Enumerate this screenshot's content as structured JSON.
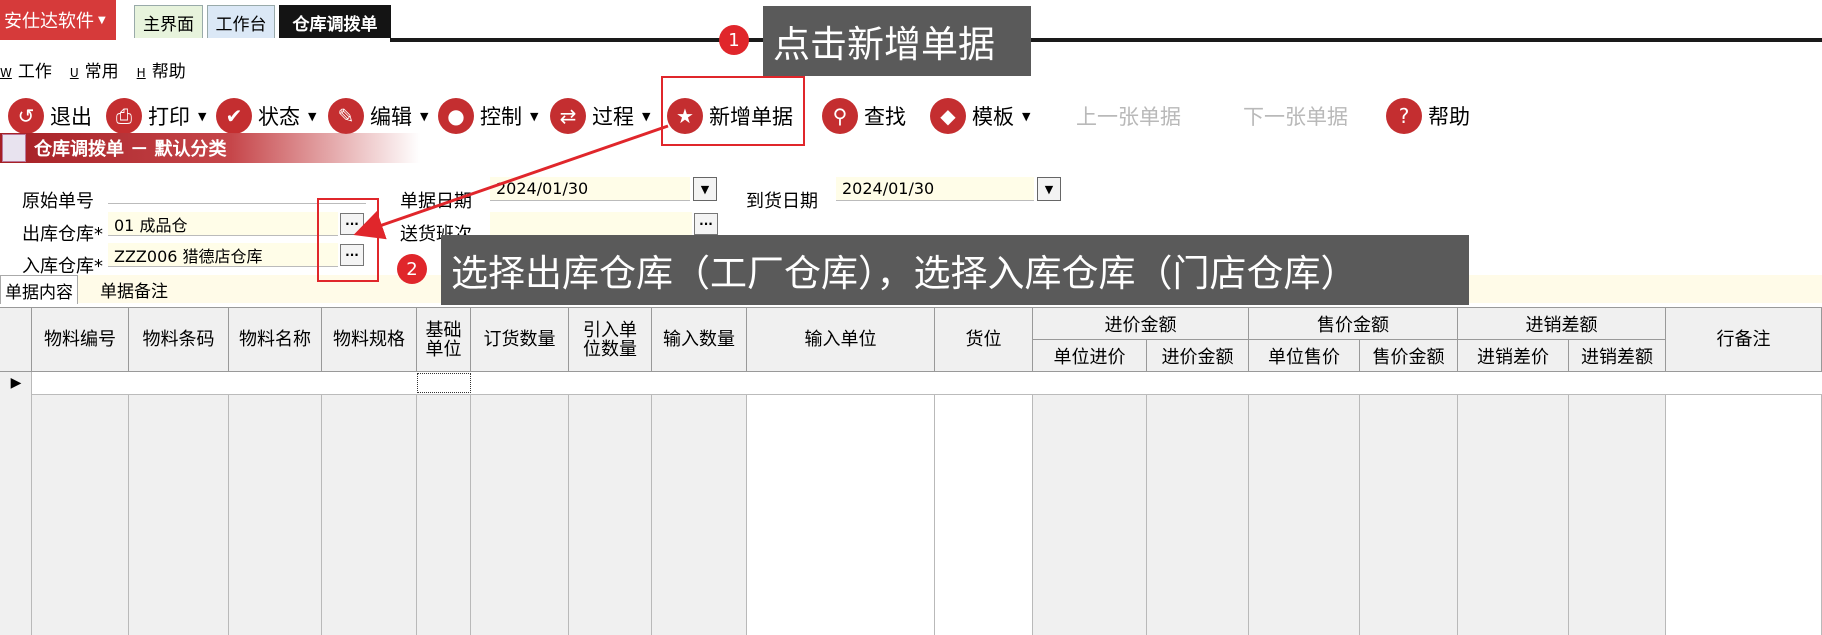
{
  "topbar": {
    "brand": "安仕达软件",
    "tabs": [
      "主界面",
      "工作台",
      "仓库调拨单"
    ]
  },
  "menu": [
    {
      "key": "W",
      "label": "工作"
    },
    {
      "key": "U",
      "label": "常用"
    },
    {
      "key": "H",
      "label": "帮助"
    }
  ],
  "toolbar": {
    "exit": "退出",
    "print": "打印",
    "status": "状态",
    "edit": "编辑",
    "control": "控制",
    "process": "过程",
    "new_doc": "新增单据",
    "find": "查找",
    "template": "模板",
    "prev": "上一张单据",
    "next": "下一张单据",
    "help": "帮助"
  },
  "header": {
    "title": "仓库调拨单 － 默认分类"
  },
  "form": {
    "orig_no_label": "原始单号",
    "out_wh_label": "出库仓库*",
    "out_wh_value": "01  成品仓",
    "in_wh_label": "入库仓库*",
    "in_wh_value": "ZZZ006  猎德店仓库",
    "doc_date_label": "单据日期",
    "doc_date_value": "2024/01/30",
    "batch_label": "送货班次",
    "arrive_date_label": "到货日期",
    "arrive_date_value": "2024/01/30"
  },
  "subtabs": [
    "单据内容",
    "单据备注"
  ],
  "grid": {
    "columns": [
      "物料编号",
      "物料条码",
      "物料名称",
      "物料规格",
      "基础单位",
      "订货数量",
      "引入单位数量",
      "输入数量",
      "输入单位",
      "货位"
    ],
    "groups": [
      {
        "label": "进价金额",
        "subs": [
          "单位进价",
          "进价金额"
        ]
      },
      {
        "label": "售价金额",
        "subs": [
          "单位售价",
          "售价金额"
        ]
      },
      {
        "label": "进销差额",
        "subs": [
          "进销差价",
          "进销差额"
        ]
      }
    ],
    "last_column": "行备注"
  },
  "annotations": {
    "step1_num": "1",
    "step1_text": "点击新增单据",
    "step2_num": "2",
    "step2_text": "选择出库仓库（工厂仓库），选择入库仓库（门店仓库）"
  },
  "colors": {
    "brand_red": "#d63a3a",
    "icon_red": "#c42e30",
    "annotation_red": "#e0262b",
    "callout_gray": "#5a5a5a",
    "field_bg": "#fffde8"
  }
}
